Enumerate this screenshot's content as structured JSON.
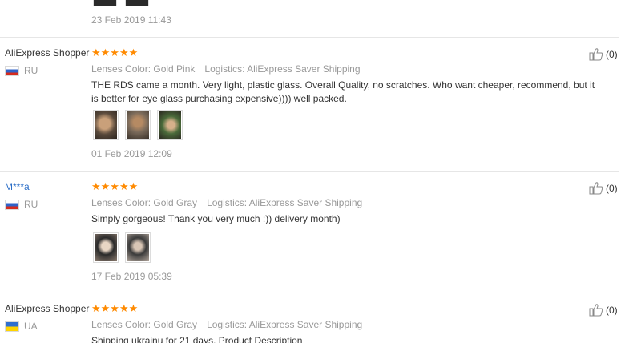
{
  "colors": {
    "star": "#ff8a00",
    "masked_name": "#2b6ec7",
    "muted": "#999999"
  },
  "previous_review": {
    "date": "23 Feb 2019 11:43"
  },
  "reviews": [
    {
      "user": "AliExpress Shopper",
      "country": "RU",
      "flag": "flag-ru",
      "stars": "★★★★★",
      "lenses": "Lenses Color: Gold Pink",
      "logistics": "Logistics: AliExpress Saver Shipping",
      "text": "THE RDS came a month. Very light, plastic glass. Overall Quality, no scratches. Who want cheaper, recommend, but it is better for eye glass purchasing expensive)))) well packed.",
      "date": "01 Feb 2019 12:09",
      "helpful": "(0)"
    },
    {
      "user": "M***a",
      "country": "RU",
      "flag": "flag-ru",
      "stars": "★★★★★",
      "lenses": "Lenses Color: Gold Gray",
      "logistics": "Logistics: AliExpress Saver Shipping",
      "text": "Simply gorgeous! Thank you very much :)) delivery month)",
      "date": "17 Feb 2019 05:39",
      "helpful": "(0)"
    },
    {
      "user": "AliExpress Shopper",
      "country": "UA",
      "flag": "flag-ua",
      "stars": "★★★★★",
      "lenses": "Lenses Color: Gold Gray",
      "logistics": "Logistics: AliExpress Saver Shipping",
      "text": "Shipping ukrainu for 21 days. Product Description",
      "helpful": "(0)"
    }
  ]
}
